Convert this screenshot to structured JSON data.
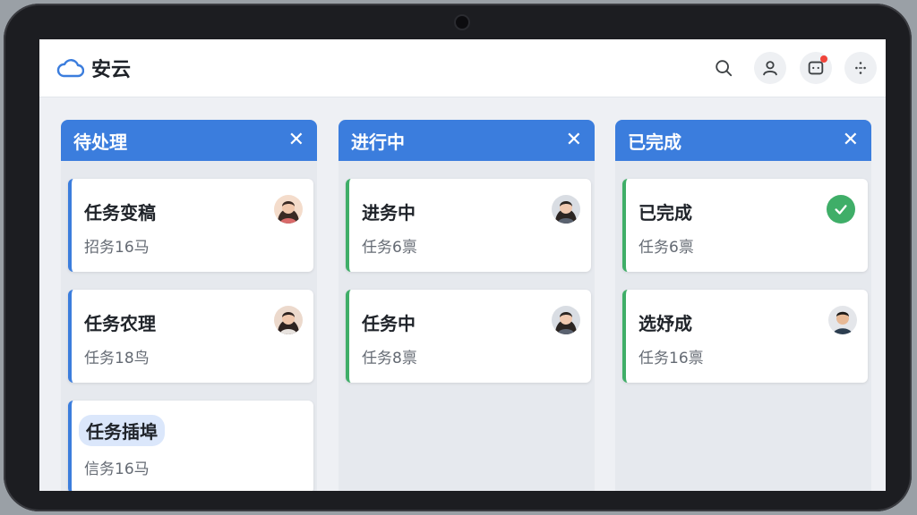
{
  "app": {
    "name": "安云"
  },
  "colors": {
    "accent": "#3b7ddd",
    "done": "#3fae68",
    "notification": "#f0443a"
  },
  "header": {
    "icons": [
      "search-icon",
      "user-icon",
      "notification-icon",
      "apps-icon"
    ]
  },
  "columns": [
    {
      "title": "待处理",
      "close": "✕",
      "cards": [
        {
          "title": "任务变稿",
          "meta": "招务16马",
          "avatar": "avatar-woman"
        },
        {
          "title": "任务农理",
          "meta": "任务18鸟",
          "avatar": "avatar-woman"
        },
        {
          "title": "任务插埠",
          "meta": "信务16马"
        }
      ]
    },
    {
      "title": "进行中",
      "close": "✕",
      "cards": [
        {
          "title": "进务中",
          "meta": "任务6禀",
          "avatar": "avatar-woman"
        },
        {
          "title": "任务中",
          "meta": "任务8禀",
          "avatar": "avatar-woman"
        }
      ]
    },
    {
      "title": "已完成",
      "close": "✕",
      "cards": [
        {
          "title": "已完成",
          "meta": "任务6禀",
          "badge": "check-icon"
        },
        {
          "title": "选妤成",
          "meta": "任务16禀",
          "avatar": "avatar-man"
        }
      ]
    }
  ]
}
